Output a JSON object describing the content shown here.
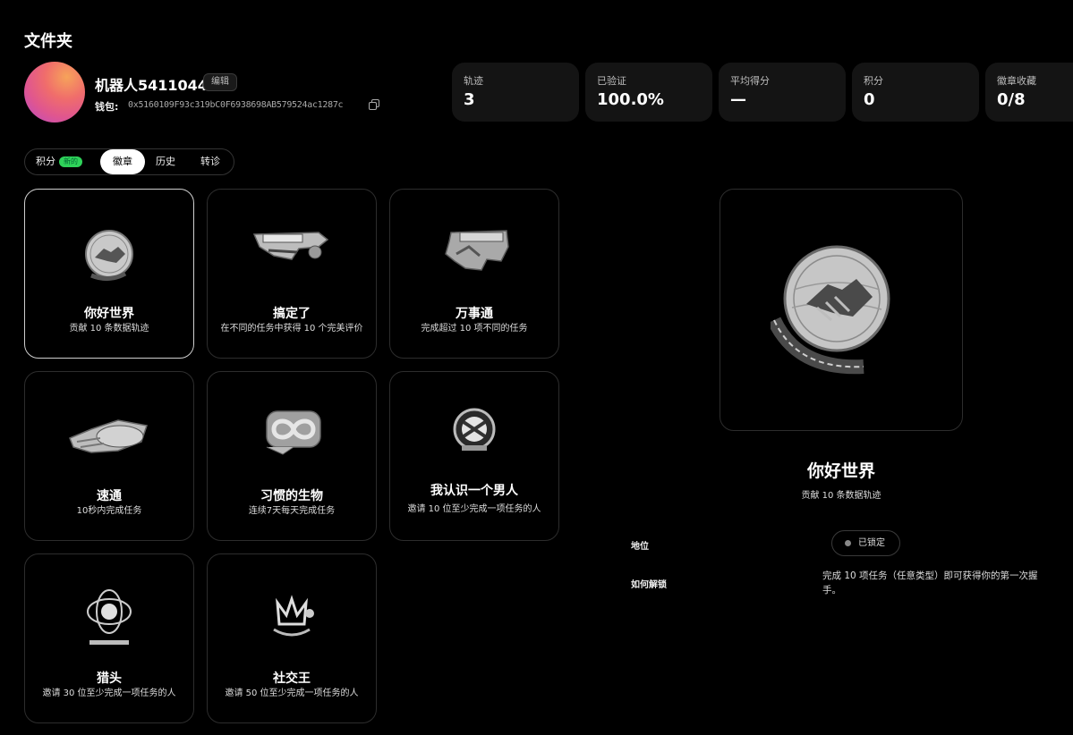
{
  "page_title": "文件夹",
  "profile": {
    "name": "机器人5411044",
    "edit_label": "编辑",
    "wallet_label": "钱包:",
    "wallet_address": "0x5160109F93c319bC0F6938698AB579524ac1287c"
  },
  "stats": [
    {
      "label": "轨迹",
      "value": "3"
    },
    {
      "label": "已验证",
      "value": "100.0%"
    },
    {
      "label": "平均得分",
      "value": "—"
    },
    {
      "label": "积分",
      "value": "0"
    },
    {
      "label": "徽章收藏",
      "value": "0/8"
    }
  ],
  "tabs": [
    {
      "label": "积分",
      "badge": "新的"
    },
    {
      "label": "徽章"
    },
    {
      "label": "历史"
    },
    {
      "label": "转诊"
    }
  ],
  "badges": [
    {
      "name": "你好世界",
      "desc": "贡献 10 条数据轨迹",
      "art_text": "Hello World"
    },
    {
      "name": "搞定了",
      "desc": "在不同的任务中获得 10 个完美评价",
      "art_text": "Nailed It"
    },
    {
      "name": "万事通",
      "desc": "完成超过 10 项不同的任务",
      "art_text": "Jack of All Trades"
    },
    {
      "name": "速通",
      "desc": "10秒内完成任务",
      "art_text": "Speedrun"
    },
    {
      "name": "习惯的生物",
      "desc": "连续7天每天完成任务",
      "art_text": "Creature of Habit"
    },
    {
      "name": "我认识一个男人",
      "desc": "邀请 10 位至少完成一项任务的人",
      "art_text": "I Know a Guy"
    },
    {
      "name": "猎头",
      "desc": "邀请 30 位至少完成一项任务的人",
      "art_text": "HEADHUNTER"
    },
    {
      "name": "社交王",
      "desc": "邀请 50 位至少完成一项任务的人",
      "art_text": "Social King"
    }
  ],
  "detail": {
    "name": "你好世界",
    "desc": "贡献 10 条数据轨迹",
    "status_label": "地位",
    "status_value": "已锁定",
    "unlock_label": "如何解锁",
    "unlock_text": "完成 10 项任务（任意类型）即可获得你的第一次握手。",
    "art_text": "Hello World"
  }
}
